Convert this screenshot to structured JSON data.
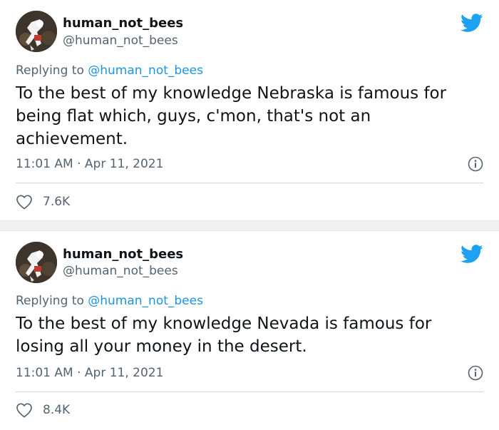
{
  "tweets": [
    {
      "display_name": "human_not_bees",
      "handle": "@human_not_bees",
      "replying_prefix": "Replying to ",
      "replying_to": "@human_not_bees",
      "text": "To the best of my knowledge Nebraska is famous for being flat which, guys, c'mon, that's not an achievement.",
      "timestamp": "11:01 AM · Apr 11, 2021",
      "likes": "7.6K"
    },
    {
      "display_name": "human_not_bees",
      "handle": "@human_not_bees",
      "replying_prefix": "Replying to ",
      "replying_to": "@human_not_bees",
      "text": "To the best of my knowledge Nevada is famous for losing all your money in the desert.",
      "timestamp": "11:01 AM · Apr 11, 2021",
      "likes": "8.4K"
    }
  ],
  "icons": {
    "brand": "twitter-bird-icon",
    "info": "info-icon",
    "like": "heart-icon"
  },
  "colors": {
    "brand_blue": "#1da1f2",
    "mention_blue": "#1b95e0",
    "text_primary": "#0f1419",
    "text_secondary": "#536471",
    "like_icon": "#536471"
  }
}
